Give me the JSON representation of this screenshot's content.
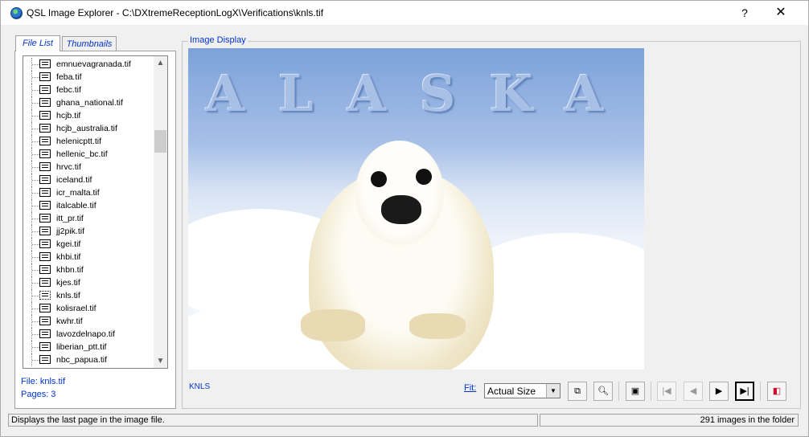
{
  "window": {
    "title": "QSL Image Explorer - C:\\DXtremeReceptionLogX\\Verifications\\knls.tif",
    "help_label": "?",
    "close_label": "✕",
    "app_icon": "globe-icon"
  },
  "tabs": [
    {
      "label": "File List",
      "active": true
    },
    {
      "label": "Thumbnails",
      "active": false
    }
  ],
  "file_list": {
    "items": [
      "emnuevagranada.tif",
      "feba.tif",
      "febc.tif",
      "ghana_national.tif",
      "hcjb.tif",
      "hcjb_australia.tif",
      "helenicptt.tif",
      "hellenic_bc.tif",
      "hrvc.tif",
      "iceland.tif",
      "icr_malta.tif",
      "italcable.tif",
      "itt_pr.tif",
      "jj2pik.tif",
      "kgei.tif",
      "khbi.tif",
      "khbn.tif",
      "kjes.tif",
      "knls.tif",
      "kolisrael.tif",
      "kwhr.tif",
      "lavozdelnapo.tif",
      "liberian_ptt.tif",
      "nbc_papua.tif"
    ],
    "selected": "knls.tif"
  },
  "file_info": {
    "file": "File: knls.tif",
    "pages": "Pages: 3"
  },
  "image_display": {
    "group_label": "Image Display",
    "image_text": "ALASKA",
    "caption": "KNLS"
  },
  "fit": {
    "label": "Fit:",
    "value": "Actual Size"
  },
  "toolbar": {
    "copy_icon": "copy-icon",
    "zoom_icon": "zoom-icon",
    "fit_window_icon": "fit-window-icon",
    "first_icon": "first-page-icon",
    "prev_icon": "previous-page-icon",
    "next_icon": "next-page-icon",
    "last_icon": "last-page-icon",
    "exit_icon": "exit-icon"
  },
  "status": {
    "message": "Displays the last page in the image file.",
    "count": "291 images in the folder"
  }
}
